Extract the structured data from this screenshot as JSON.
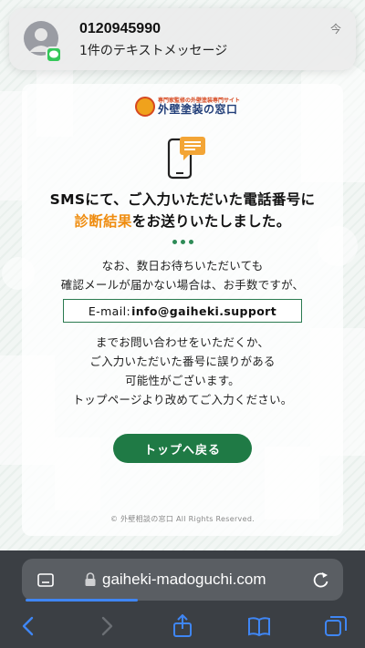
{
  "notification": {
    "sender": "0120945990",
    "preview": "1件のテキストメッセージ",
    "time": "今"
  },
  "logo": {
    "subtitle": "専門家監修の外壁塗装専門サイト",
    "name": "外壁塗装の窓口"
  },
  "headline": {
    "line1": "SMSにて、ご入力いただいた電話番号に",
    "line2_accent": "診断結果",
    "line2_rest": "をお送りいたしました。"
  },
  "notice": {
    "line1": "なお、数日お待ちいただいても",
    "line2": "確認メールが届かない場合は、お手数ですが、"
  },
  "email": {
    "label": "E-mail:",
    "address": "info@gaiheki.support"
  },
  "followup": {
    "line1": "までお問い合わせをいただくか、",
    "line2": "ご入力いただいた番号に誤りがある",
    "line3": "可能性がございます。",
    "line4": "トップページより改めてご入力ください。"
  },
  "top_button_label": "トップへ戻る",
  "copyright": "© 外壁相談の窓口 All Rights Reserved.",
  "browser": {
    "url": "gaiheki-madoguchi.com",
    "load_progress": 0.35
  },
  "colors": {
    "accent_orange": "#ef8d11",
    "brand_green": "#1f7a45",
    "notification_app_green": "#34c759",
    "safari_blue": "#3f86f4"
  },
  "icons": [
    "contact-avatar-icon",
    "messages-app-icon",
    "smartphone-message-icon",
    "tabs-icon",
    "lock-icon",
    "reload-icon",
    "back-icon",
    "forward-icon",
    "share-icon",
    "bookmarks-icon",
    "tab-overview-icon"
  ]
}
